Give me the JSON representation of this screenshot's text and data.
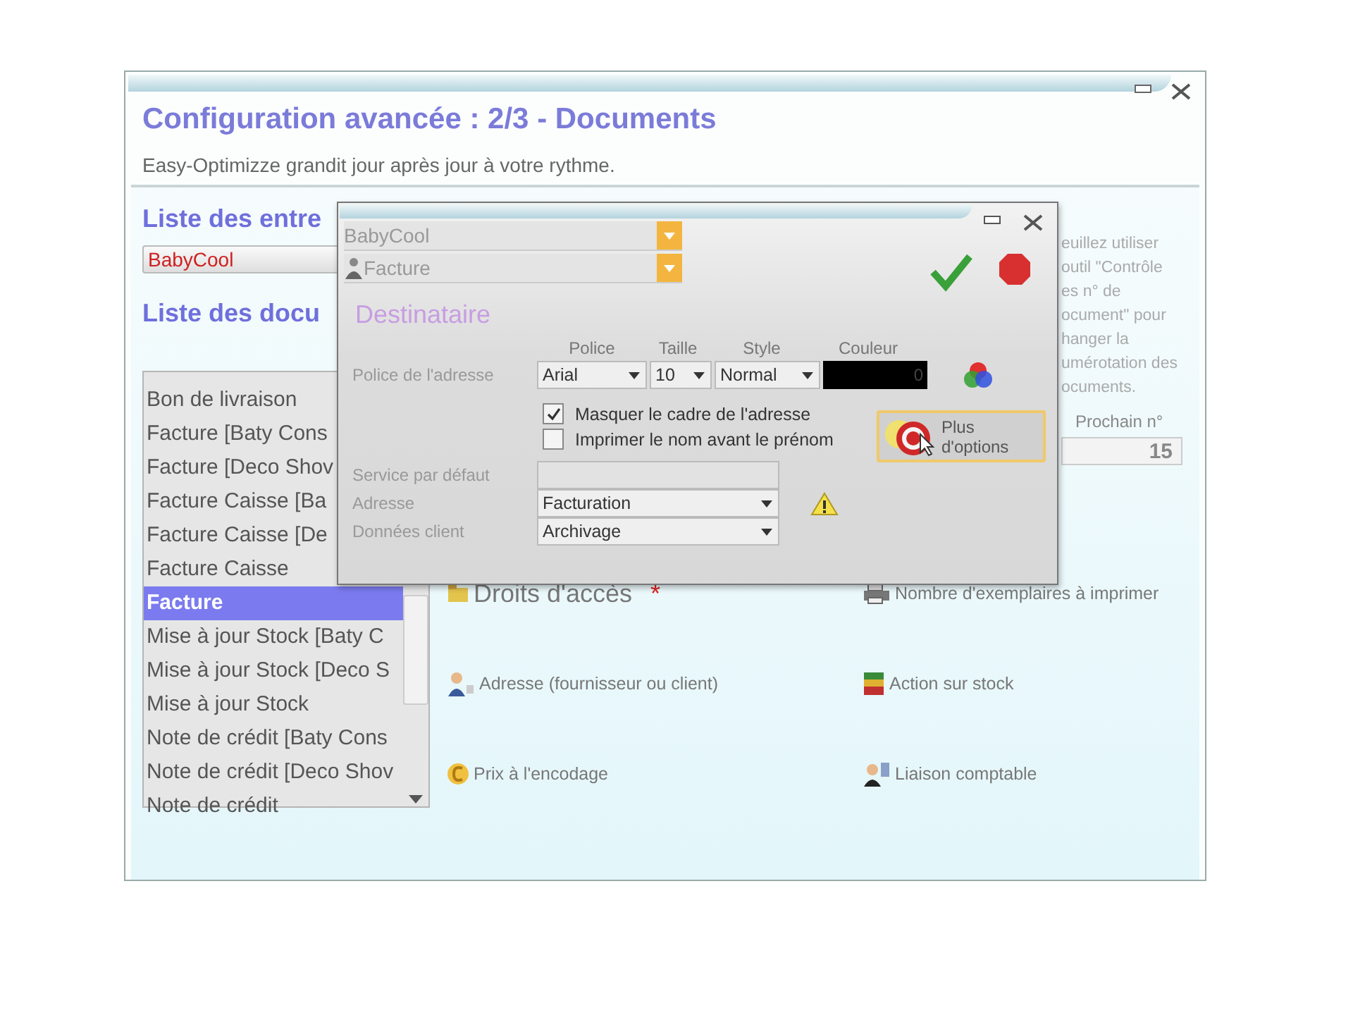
{
  "window": {
    "title": "Configuration avancée : 2/3  -  Documents",
    "subtitle": "Easy-Optimizze grandit jour après jour à votre rythme."
  },
  "companies": {
    "heading": "Liste des entre",
    "value": "BabyCool"
  },
  "documents": {
    "heading": "Liste des docu",
    "items": [
      {
        "label": "Bon de livraison",
        "selected": false
      },
      {
        "label": "Facture [Baty Cons",
        "selected": false
      },
      {
        "label": "Facture [Deco Shov",
        "selected": false
      },
      {
        "label": "Facture Caisse [Ba",
        "selected": false
      },
      {
        "label": "Facture Caisse [De",
        "selected": false
      },
      {
        "label": "Facture Caisse",
        "selected": false
      },
      {
        "label": "Facture",
        "selected": true
      },
      {
        "label": "Mise à jour Stock [Baty C",
        "selected": false
      },
      {
        "label": "Mise à jour Stock [Deco S",
        "selected": false
      },
      {
        "label": "Mise à jour Stock",
        "selected": false
      },
      {
        "label": "Note de crédit [Baty Cons",
        "selected": false
      },
      {
        "label": "Note de crédit [Deco Shov",
        "selected": false
      },
      {
        "label": "Note de crédit",
        "selected": false
      }
    ]
  },
  "options": [
    {
      "label": "Droits d'accès",
      "kind": "heading",
      "mark": "*"
    },
    {
      "label": "Nombre d'exemplaires à imprimer",
      "kind": "link"
    },
    {
      "label": "Adresse (fournisseur ou client)",
      "kind": "link"
    },
    {
      "label": "Action sur stock",
      "kind": "link"
    },
    {
      "label": "Prix à l'encodage",
      "kind": "link"
    },
    {
      "label": "Liaison comptable",
      "kind": "link"
    }
  ],
  "help": {
    "lines": [
      "euillez utiliser",
      "outil \"Contrôle",
      "es n° de",
      "ocument\" pour",
      "hanger la",
      "umérotation des",
      "ocuments."
    ],
    "next_label": "Prochain n°",
    "next_value": "15"
  },
  "dialog": {
    "company": "BabyCool",
    "document": "Facture",
    "section": "Destinataire",
    "font_row": {
      "label": "Police de l'adresse",
      "columns": [
        "Police",
        "Taille",
        "Style",
        "Couleur"
      ],
      "font": "Arial",
      "size": "10",
      "style": "Normal",
      "color_value": "0"
    },
    "checkboxes": [
      {
        "label": "Masquer le cadre de l'adresse",
        "checked": true
      },
      {
        "label": "Imprimer le nom avant le prénom",
        "checked": false
      }
    ],
    "more_button": "Plus d'options",
    "fields": [
      {
        "label": "Service par défaut",
        "kind": "text"
      },
      {
        "label": "Adresse",
        "kind": "select",
        "value": "Facturation"
      },
      {
        "label": "Données client",
        "kind": "select",
        "value": "Archivage"
      }
    ]
  }
}
